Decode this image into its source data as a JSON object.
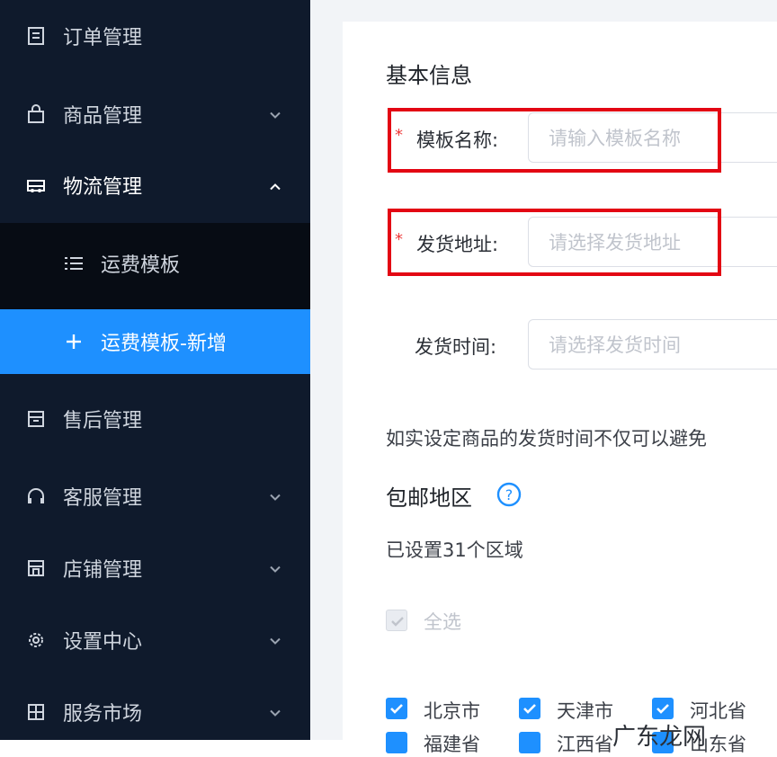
{
  "sidebar": {
    "items": [
      {
        "label": "订单管理",
        "icon": "document-icon"
      },
      {
        "label": "商品管理",
        "icon": "bag-icon",
        "chevron": "down"
      },
      {
        "label": "物流管理",
        "icon": "truck-icon",
        "chevron": "up"
      },
      {
        "label": "运费模板",
        "icon": "list-icon"
      },
      {
        "label": "运费模板-新增",
        "icon": "plus-icon"
      },
      {
        "label": "售后管理",
        "icon": "store-icon"
      },
      {
        "label": "客服管理",
        "icon": "headset-icon",
        "chevron": "down"
      },
      {
        "label": "店铺管理",
        "icon": "shop-icon",
        "chevron": "down"
      },
      {
        "label": "设置中心",
        "icon": "gear-icon",
        "chevron": "down"
      },
      {
        "label": "服务市场",
        "icon": "grid-icon",
        "chevron": "down"
      }
    ]
  },
  "form": {
    "section_basic": "基本信息",
    "required_mark": "*",
    "template_name_label": "模板名称:",
    "template_name_placeholder": "请输入模板名称",
    "ship_address_label": "发货地址:",
    "ship_address_placeholder": "请选择发货地址",
    "ship_time_label": "发货时间:",
    "ship_time_placeholder": "请选择发货时间",
    "hint_text": "如实设定商品的发货时间不仅可以避免",
    "section_free_shipping": "包邮地区",
    "help_icon": "question-circle-icon",
    "regions_set_text": "已设置31个区域",
    "select_all_label": "全选",
    "regions_row1": [
      "北京市",
      "天津市",
      "河北省"
    ],
    "regions_row2": [
      "福建省",
      "江西省",
      "山东省"
    ]
  },
  "watermark": {
    "text": "广东龙网"
  },
  "colors": {
    "sidebar_bg": "#0f1a2c",
    "selected_item": "#1e90ff",
    "highlight_box": "#e30613",
    "required": "#ee3b3b"
  }
}
